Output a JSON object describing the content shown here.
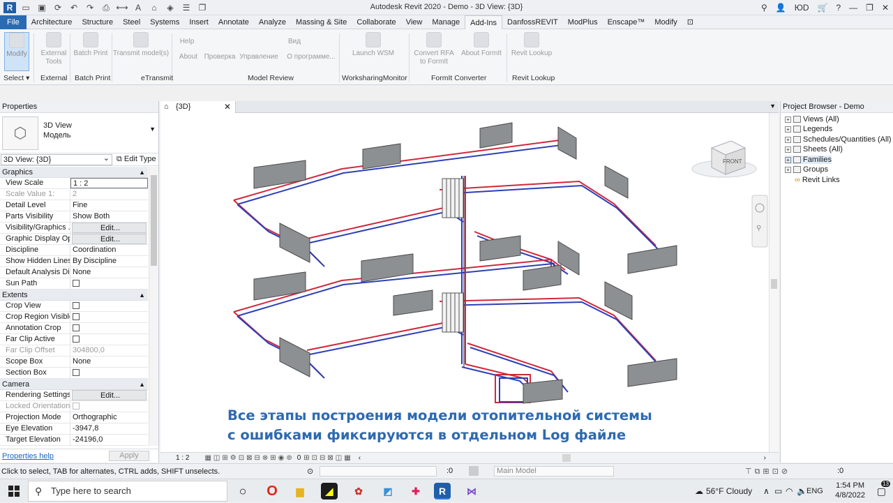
{
  "title_bar": {
    "title": "Autodesk Revit 2020 - Demo - 3D View: {3D}",
    "user": "ЮD"
  },
  "menu": {
    "tabs": [
      "File",
      "Architecture",
      "Structure",
      "Steel",
      "Systems",
      "Insert",
      "Annotate",
      "Analyze",
      "Massing & Site",
      "Collaborate",
      "View",
      "Manage",
      "Add-Ins",
      "DanfossREVIT",
      "ModPlus",
      "Enscape™",
      "Modify"
    ],
    "active": "Add-Ins"
  },
  "ribbon": {
    "buttons": [
      {
        "label": "Modify"
      },
      {
        "label": "External Tools"
      },
      {
        "label": "Batch Print"
      },
      {
        "label": "Transmit model(s)"
      },
      {
        "label": "Help"
      },
      {
        "label": "About"
      },
      {
        "label": "Проверка"
      },
      {
        "label": "Управление"
      },
      {
        "label": "Вид"
      },
      {
        "label": "О программе..."
      },
      {
        "label": "Launch WSM"
      },
      {
        "label": "Convert RFA to FormIt"
      },
      {
        "label": "About FormIt"
      },
      {
        "label": "Revit Lookup"
      }
    ],
    "groups": [
      "Select",
      "External",
      "Batch Print",
      "eTransmit",
      "Model Review",
      "WorksharingMonitor",
      "FormIt Converter",
      "Revit Lookup"
    ]
  },
  "properties": {
    "header": "Properties",
    "type_line1": "3D View",
    "type_line2": "Модель",
    "selector": "3D View: {3D}",
    "edit_type": "Edit Type",
    "sections": {
      "graphics": "Graphics",
      "extents": "Extents",
      "camera": "Camera"
    },
    "rows": [
      {
        "k": "View Scale",
        "v": "1 : 2"
      },
      {
        "k": "Scale Value    1:",
        "v": "2"
      },
      {
        "k": "Detail Level",
        "v": "Fine"
      },
      {
        "k": "Parts Visibility",
        "v": "Show Both"
      },
      {
        "k": "Visibility/Graphics ...",
        "v": "Edit..."
      },
      {
        "k": "Graphic Display Op...",
        "v": "Edit..."
      },
      {
        "k": "Discipline",
        "v": "Coordination"
      },
      {
        "k": "Show Hidden Lines",
        "v": "By Discipline"
      },
      {
        "k": "Default Analysis Di...",
        "v": "None"
      },
      {
        "k": "Sun Path",
        "v": ""
      },
      {
        "k": "Crop View",
        "v": ""
      },
      {
        "k": "Crop Region Visible",
        "v": ""
      },
      {
        "k": "Annotation Crop",
        "v": ""
      },
      {
        "k": "Far Clip Active",
        "v": ""
      },
      {
        "k": "Far Clip Offset",
        "v": "304800,0"
      },
      {
        "k": "Scope Box",
        "v": "None"
      },
      {
        "k": "Section Box",
        "v": ""
      },
      {
        "k": "Rendering Settings",
        "v": "Edit..."
      },
      {
        "k": "Locked Orientation",
        "v": ""
      },
      {
        "k": "Projection Mode",
        "v": "Orthographic"
      },
      {
        "k": "Eye Elevation",
        "v": "-3947,8"
      },
      {
        "k": "Target Elevation",
        "v": "-24196,0"
      }
    ],
    "help": "Properties help",
    "apply": "Apply"
  },
  "view": {
    "tab": "{3D}",
    "scale": "1 : 2",
    "cube_face": "FRONT",
    "detail": "0"
  },
  "caption": {
    "line1": "Все этапы построения модели отопительной системы",
    "line2": "с ошибками фиксируются в отдельном Log файле"
  },
  "project_browser": {
    "header": "Project Browser - Demo",
    "items": [
      "Views (All)",
      "Legends",
      "Schedules/Quantities (All)",
      "Sheets (All)",
      "Families",
      "Groups",
      "Revit Links"
    ]
  },
  "status": {
    "message": "Click to select, TAB for alternates, CTRL adds, SHIFT unselects.",
    "worksets": ":0",
    "model": "Main Model",
    "filter": ":0"
  },
  "taskbar": {
    "search": "Type here to search",
    "weather": "56°F  Cloudy",
    "lang": "ENG",
    "time": "1:54 PM",
    "date": "4/8/2022",
    "badge": "13"
  }
}
